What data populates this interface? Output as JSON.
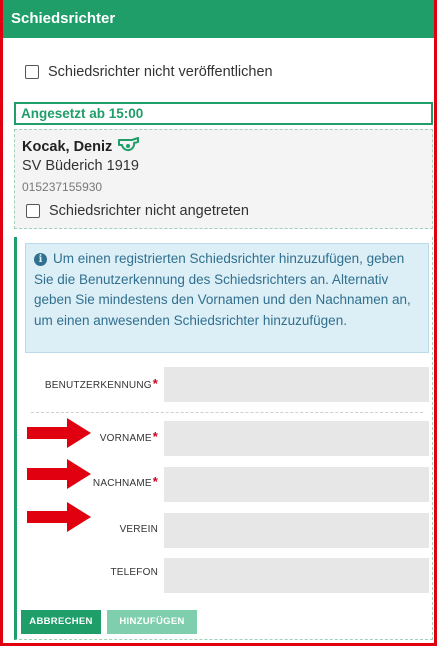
{
  "header": {
    "title": "Schiedsrichter"
  },
  "publish_checkbox": {
    "label": "Schiedsrichter nicht veröffentlichen",
    "checked": false
  },
  "assigned": {
    "label": "Angesetzt ab 15:00"
  },
  "referee": {
    "name": "Kocak, Deniz",
    "club": "SV Büderich 1919",
    "phone": "015237155930",
    "whistle_icon": "whistle-icon",
    "not_attended": {
      "label": "Schiedsrichter nicht angetreten",
      "checked": false
    }
  },
  "info": {
    "icon": "info-icon",
    "text": "Um einen registrierten Schiedsrichter hinzuzufügen, geben Sie die Benutzerkennung des Schiedsrichters an. Alternativ geben Sie mindestens den Vornamen und den Nachnamen an, um einen anwesenden Schiedsrichter hinzuzufügen."
  },
  "form": {
    "username": {
      "label": "BENUTZERKENNUNG",
      "required": "*",
      "value": ""
    },
    "firstname": {
      "label": "VORNAME",
      "required": "*",
      "value": ""
    },
    "lastname": {
      "label": "NACHNAME",
      "required": "*",
      "value": ""
    },
    "club": {
      "label": "VEREIN",
      "value": ""
    },
    "phone": {
      "label": "TELEFON",
      "value": ""
    }
  },
  "buttons": {
    "cancel": "ABBRECHEN",
    "add": "HINZUFÜGEN"
  },
  "colors": {
    "accent": "#1f9e6a",
    "arrow": "#e0000f",
    "info_bg": "#dceef6",
    "info_text": "#31708f"
  }
}
